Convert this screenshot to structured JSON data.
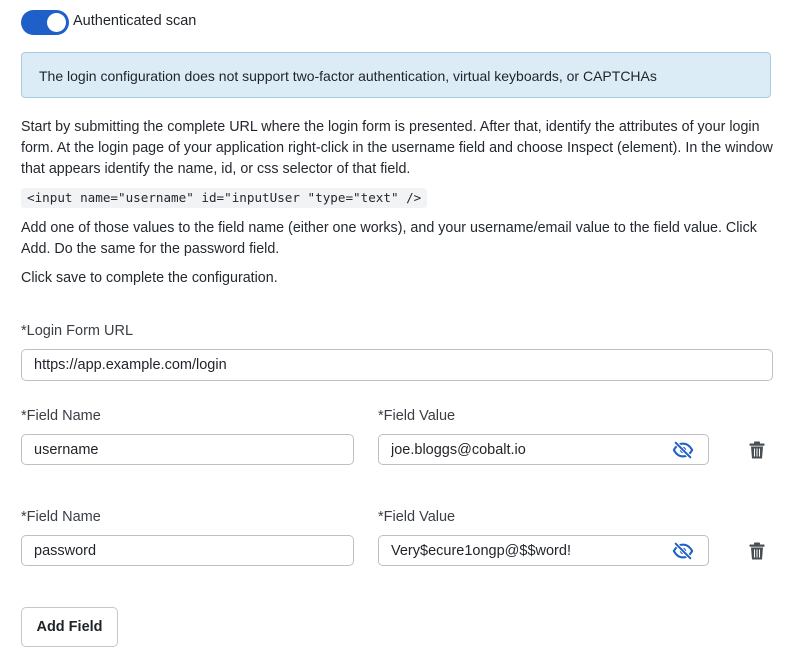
{
  "auth_toggle": {
    "label": "Authenticated scan",
    "enabled": true
  },
  "alert": {
    "text": "The login configuration does not support two-factor authentication, virtual keyboards, or CAPTCHAs"
  },
  "instructions": {
    "p1": "Start by submitting the complete URL where the login form is presented. After that, identify the attributes of your login form. At the login page of your application right-click in the username field and choose Inspect (element). In the window that appears identify the name, id, or css selector of that field.",
    "code": "<input name=\"username\" id=\"inputUser \"type=\"text\" />",
    "p2": "Add one of those values to the field name (either one works), and your username/email value to the field value. Click Add. Do the same for the password field.",
    "p3": "Click save to complete the configuration."
  },
  "login_url": {
    "label": "*Login Form URL",
    "value": "https://app.example.com/login"
  },
  "fields": [
    {
      "name_label": "*Field Name",
      "name_value": "username",
      "value_label": "*Field Value",
      "value": "joe.bloggs@cobalt.io",
      "eye_icon": "eye-off-icon",
      "delete_icon": "trash-icon"
    },
    {
      "name_label": "*Field Name",
      "name_value": "password",
      "value_label": "*Field Value",
      "value": "Very$ecure1ongp@$$word!",
      "eye_icon": "eye-off-icon",
      "delete_icon": "trash-icon"
    }
  ],
  "add_field_button": {
    "label": "Add Field"
  },
  "colors": {
    "toggle_on": "#1f5fc8",
    "alert_bg": "#dcecf6",
    "alert_border": "#a8cde3",
    "icon": "#1f5fc8",
    "trash": "#4a4f55"
  }
}
